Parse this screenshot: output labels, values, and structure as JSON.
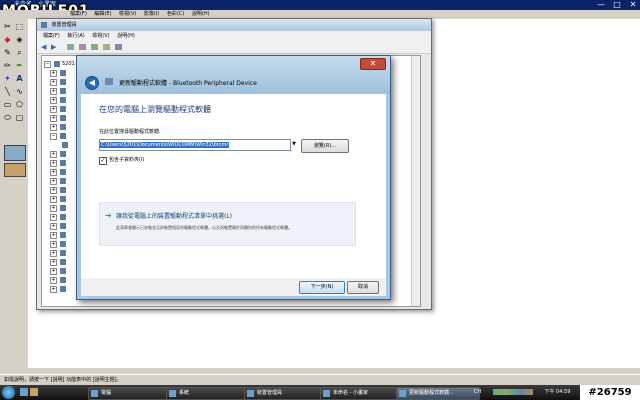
{
  "paint": {
    "title": "未命名 - 小畫家",
    "logo": "MOBILE01",
    "menu": [
      "檔案(F)",
      "編輯(E)",
      "檢視(V)",
      "影像(I)",
      "色彩(C)",
      "說明(H)"
    ],
    "status_text": "如需說明，請按一下 [說明] 功能表中的 [說明主題]。"
  },
  "device_manager": {
    "title": "裝置管理員",
    "menu": [
      "檔案(F)",
      "執行(A)",
      "檢視(V)",
      "說明(H)"
    ],
    "root_node": "5201"
  },
  "dialog": {
    "title": "更新驅動程式軟體 - Bluetooth Peripheral Device",
    "close_label": "✕",
    "heading": "在您的電腦上瀏覽驅動程式軟體",
    "path_label": "在此位置搜尋驅動程式軟體:",
    "path_value": "C:\\Users\\5201\\Documents\\WIDCOMM\\Win32\\btcmr",
    "browse_label": "瀏覽(R)...",
    "include_subfolders_label": "包含子資料夾(I)",
    "include_subfolders_checked": true,
    "pick_title": "讓我從電腦上的裝置驅動程式清單中挑選(L)",
    "pick_desc": "此清單會顯示已安裝並且與裝置相容的驅動程式軟體，以及與裝置屬於同類別的所有驅動程式軟體。",
    "next_label": "下一步(N)",
    "cancel_label": "取消"
  },
  "taskbar": {
    "tasks": [
      "電腦",
      "系統",
      "裝置管理員",
      "未命名 - 小畫家",
      "更新驅動程式軟體..."
    ],
    "active_index": 4,
    "language": "CH",
    "clock": "下午 04:59"
  },
  "watermark": "#26759",
  "colors": {
    "title_bar": "#0a246a",
    "dialog_frame": "#a6c8e4",
    "close_button": "#c84838",
    "taskbar": "#101010"
  }
}
